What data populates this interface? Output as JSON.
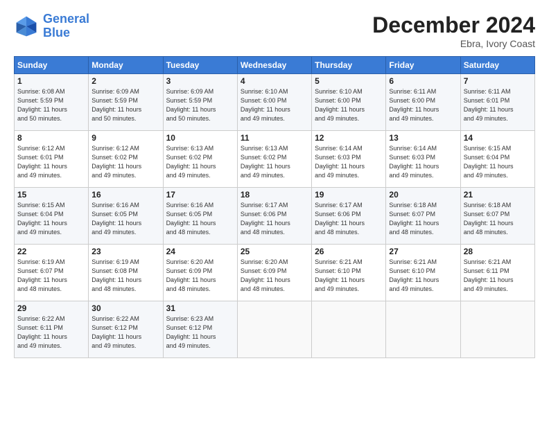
{
  "logo": {
    "line1": "General",
    "line2": "Blue"
  },
  "title": "December 2024",
  "subtitle": "Ebra, Ivory Coast",
  "header_days": [
    "Sunday",
    "Monday",
    "Tuesday",
    "Wednesday",
    "Thursday",
    "Friday",
    "Saturday"
  ],
  "weeks": [
    [
      {
        "day": "1",
        "detail": "Sunrise: 6:08 AM\nSunset: 5:59 PM\nDaylight: 11 hours\nand 50 minutes."
      },
      {
        "day": "2",
        "detail": "Sunrise: 6:09 AM\nSunset: 5:59 PM\nDaylight: 11 hours\nand 50 minutes."
      },
      {
        "day": "3",
        "detail": "Sunrise: 6:09 AM\nSunset: 5:59 PM\nDaylight: 11 hours\nand 50 minutes."
      },
      {
        "day": "4",
        "detail": "Sunrise: 6:10 AM\nSunset: 6:00 PM\nDaylight: 11 hours\nand 49 minutes."
      },
      {
        "day": "5",
        "detail": "Sunrise: 6:10 AM\nSunset: 6:00 PM\nDaylight: 11 hours\nand 49 minutes."
      },
      {
        "day": "6",
        "detail": "Sunrise: 6:11 AM\nSunset: 6:00 PM\nDaylight: 11 hours\nand 49 minutes."
      },
      {
        "day": "7",
        "detail": "Sunrise: 6:11 AM\nSunset: 6:01 PM\nDaylight: 11 hours\nand 49 minutes."
      }
    ],
    [
      {
        "day": "8",
        "detail": "Sunrise: 6:12 AM\nSunset: 6:01 PM\nDaylight: 11 hours\nand 49 minutes."
      },
      {
        "day": "9",
        "detail": "Sunrise: 6:12 AM\nSunset: 6:02 PM\nDaylight: 11 hours\nand 49 minutes."
      },
      {
        "day": "10",
        "detail": "Sunrise: 6:13 AM\nSunset: 6:02 PM\nDaylight: 11 hours\nand 49 minutes."
      },
      {
        "day": "11",
        "detail": "Sunrise: 6:13 AM\nSunset: 6:02 PM\nDaylight: 11 hours\nand 49 minutes."
      },
      {
        "day": "12",
        "detail": "Sunrise: 6:14 AM\nSunset: 6:03 PM\nDaylight: 11 hours\nand 49 minutes."
      },
      {
        "day": "13",
        "detail": "Sunrise: 6:14 AM\nSunset: 6:03 PM\nDaylight: 11 hours\nand 49 minutes."
      },
      {
        "day": "14",
        "detail": "Sunrise: 6:15 AM\nSunset: 6:04 PM\nDaylight: 11 hours\nand 49 minutes."
      }
    ],
    [
      {
        "day": "15",
        "detail": "Sunrise: 6:15 AM\nSunset: 6:04 PM\nDaylight: 11 hours\nand 49 minutes."
      },
      {
        "day": "16",
        "detail": "Sunrise: 6:16 AM\nSunset: 6:05 PM\nDaylight: 11 hours\nand 49 minutes."
      },
      {
        "day": "17",
        "detail": "Sunrise: 6:16 AM\nSunset: 6:05 PM\nDaylight: 11 hours\nand 48 minutes."
      },
      {
        "day": "18",
        "detail": "Sunrise: 6:17 AM\nSunset: 6:06 PM\nDaylight: 11 hours\nand 48 minutes."
      },
      {
        "day": "19",
        "detail": "Sunrise: 6:17 AM\nSunset: 6:06 PM\nDaylight: 11 hours\nand 48 minutes."
      },
      {
        "day": "20",
        "detail": "Sunrise: 6:18 AM\nSunset: 6:07 PM\nDaylight: 11 hours\nand 48 minutes."
      },
      {
        "day": "21",
        "detail": "Sunrise: 6:18 AM\nSunset: 6:07 PM\nDaylight: 11 hours\nand 48 minutes."
      }
    ],
    [
      {
        "day": "22",
        "detail": "Sunrise: 6:19 AM\nSunset: 6:07 PM\nDaylight: 11 hours\nand 48 minutes."
      },
      {
        "day": "23",
        "detail": "Sunrise: 6:19 AM\nSunset: 6:08 PM\nDaylight: 11 hours\nand 48 minutes."
      },
      {
        "day": "24",
        "detail": "Sunrise: 6:20 AM\nSunset: 6:09 PM\nDaylight: 11 hours\nand 48 minutes."
      },
      {
        "day": "25",
        "detail": "Sunrise: 6:20 AM\nSunset: 6:09 PM\nDaylight: 11 hours\nand 48 minutes."
      },
      {
        "day": "26",
        "detail": "Sunrise: 6:21 AM\nSunset: 6:10 PM\nDaylight: 11 hours\nand 49 minutes."
      },
      {
        "day": "27",
        "detail": "Sunrise: 6:21 AM\nSunset: 6:10 PM\nDaylight: 11 hours\nand 49 minutes."
      },
      {
        "day": "28",
        "detail": "Sunrise: 6:21 AM\nSunset: 6:11 PM\nDaylight: 11 hours\nand 49 minutes."
      }
    ],
    [
      {
        "day": "29",
        "detail": "Sunrise: 6:22 AM\nSunset: 6:11 PM\nDaylight: 11 hours\nand 49 minutes."
      },
      {
        "day": "30",
        "detail": "Sunrise: 6:22 AM\nSunset: 6:12 PM\nDaylight: 11 hours\nand 49 minutes."
      },
      {
        "day": "31",
        "detail": "Sunrise: 6:23 AM\nSunset: 6:12 PM\nDaylight: 11 hours\nand 49 minutes."
      },
      {
        "day": "",
        "detail": ""
      },
      {
        "day": "",
        "detail": ""
      },
      {
        "day": "",
        "detail": ""
      },
      {
        "day": "",
        "detail": ""
      }
    ]
  ]
}
